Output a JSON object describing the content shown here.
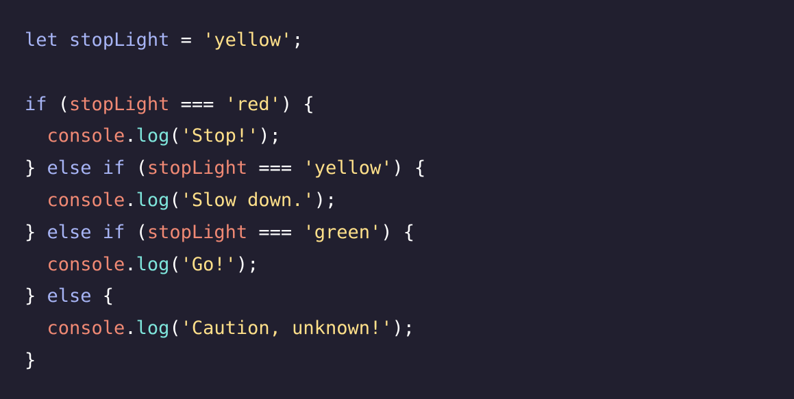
{
  "colors": {
    "background": "#211f2f",
    "keyword": "#a7b4f5",
    "variable": "#f08974",
    "method": "#7fe6dc",
    "string": "#ffe08a",
    "punctuation": "#ffffff"
  },
  "code": {
    "lines": [
      [
        {
          "t": "let",
          "c": "keyword"
        },
        {
          "t": " ",
          "c": "punct"
        },
        {
          "t": "stopLight",
          "c": "ident"
        },
        {
          "t": " = ",
          "c": "punct"
        },
        {
          "t": "'yellow'",
          "c": "string"
        },
        {
          "t": ";",
          "c": "punct"
        }
      ],
      [],
      [
        {
          "t": "if",
          "c": "keyword"
        },
        {
          "t": " (",
          "c": "punct"
        },
        {
          "t": "stopLight",
          "c": "var"
        },
        {
          "t": " === ",
          "c": "punct"
        },
        {
          "t": "'red'",
          "c": "string"
        },
        {
          "t": ") {",
          "c": "punct"
        }
      ],
      [
        {
          "t": "  ",
          "c": "punct"
        },
        {
          "t": "console",
          "c": "obj"
        },
        {
          "t": ".",
          "c": "punct"
        },
        {
          "t": "log",
          "c": "method"
        },
        {
          "t": "(",
          "c": "punct"
        },
        {
          "t": "'Stop!'",
          "c": "string"
        },
        {
          "t": ");",
          "c": "punct"
        }
      ],
      [
        {
          "t": "} ",
          "c": "punct"
        },
        {
          "t": "else",
          "c": "keyword"
        },
        {
          "t": " ",
          "c": "punct"
        },
        {
          "t": "if",
          "c": "keyword"
        },
        {
          "t": " (",
          "c": "punct"
        },
        {
          "t": "stopLight",
          "c": "var"
        },
        {
          "t": " === ",
          "c": "punct"
        },
        {
          "t": "'yellow'",
          "c": "string"
        },
        {
          "t": ") {",
          "c": "punct"
        }
      ],
      [
        {
          "t": "  ",
          "c": "punct"
        },
        {
          "t": "console",
          "c": "obj"
        },
        {
          "t": ".",
          "c": "punct"
        },
        {
          "t": "log",
          "c": "method"
        },
        {
          "t": "(",
          "c": "punct"
        },
        {
          "t": "'Slow down.'",
          "c": "string"
        },
        {
          "t": ");",
          "c": "punct"
        }
      ],
      [
        {
          "t": "} ",
          "c": "punct"
        },
        {
          "t": "else",
          "c": "keyword"
        },
        {
          "t": " ",
          "c": "punct"
        },
        {
          "t": "if",
          "c": "keyword"
        },
        {
          "t": " (",
          "c": "punct"
        },
        {
          "t": "stopLight",
          "c": "var"
        },
        {
          "t": " === ",
          "c": "punct"
        },
        {
          "t": "'green'",
          "c": "string"
        },
        {
          "t": ") {",
          "c": "punct"
        }
      ],
      [
        {
          "t": "  ",
          "c": "punct"
        },
        {
          "t": "console",
          "c": "obj"
        },
        {
          "t": ".",
          "c": "punct"
        },
        {
          "t": "log",
          "c": "method"
        },
        {
          "t": "(",
          "c": "punct"
        },
        {
          "t": "'Go!'",
          "c": "string"
        },
        {
          "t": ");",
          "c": "punct"
        }
      ],
      [
        {
          "t": "} ",
          "c": "punct"
        },
        {
          "t": "else",
          "c": "keyword"
        },
        {
          "t": " {",
          "c": "punct"
        }
      ],
      [
        {
          "t": "  ",
          "c": "punct"
        },
        {
          "t": "console",
          "c": "obj"
        },
        {
          "t": ".",
          "c": "punct"
        },
        {
          "t": "log",
          "c": "method"
        },
        {
          "t": "(",
          "c": "punct"
        },
        {
          "t": "'Caution, unknown!'",
          "c": "string"
        },
        {
          "t": ");",
          "c": "punct"
        }
      ],
      [
        {
          "t": "}",
          "c": "punct"
        }
      ]
    ]
  }
}
